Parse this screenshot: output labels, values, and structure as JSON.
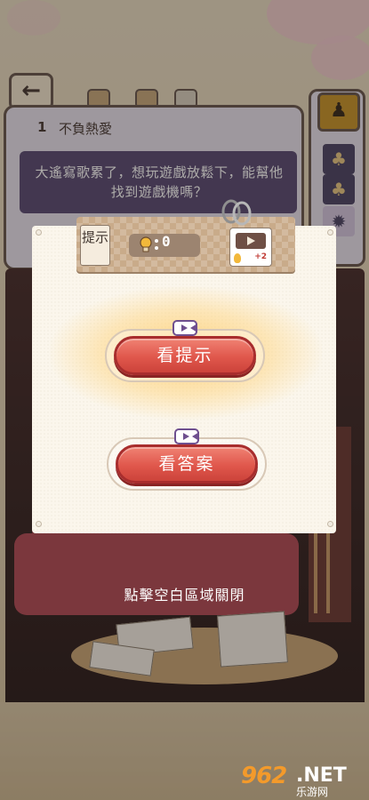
{
  "level": {
    "number": "1",
    "title": "不負熱愛",
    "question": "大遙寫歌累了，想玩遊戲放鬆下，能幫他找到遊戲機嗎？"
  },
  "hint_dialog": {
    "tab_label": "提示",
    "hint_count": "0",
    "video_reward": "+2",
    "watch_hint_label": "看提示",
    "watch_answer_label": "看答案",
    "close_text": "點擊空白區域關閉"
  },
  "watermark": {
    "number": "962",
    "suffix": ".NET",
    "subtitle": "乐游网"
  },
  "colors": {
    "accent_red": "#e0574c",
    "video_purple": "#6e4f8f",
    "question_bg": "#5c4e77"
  }
}
